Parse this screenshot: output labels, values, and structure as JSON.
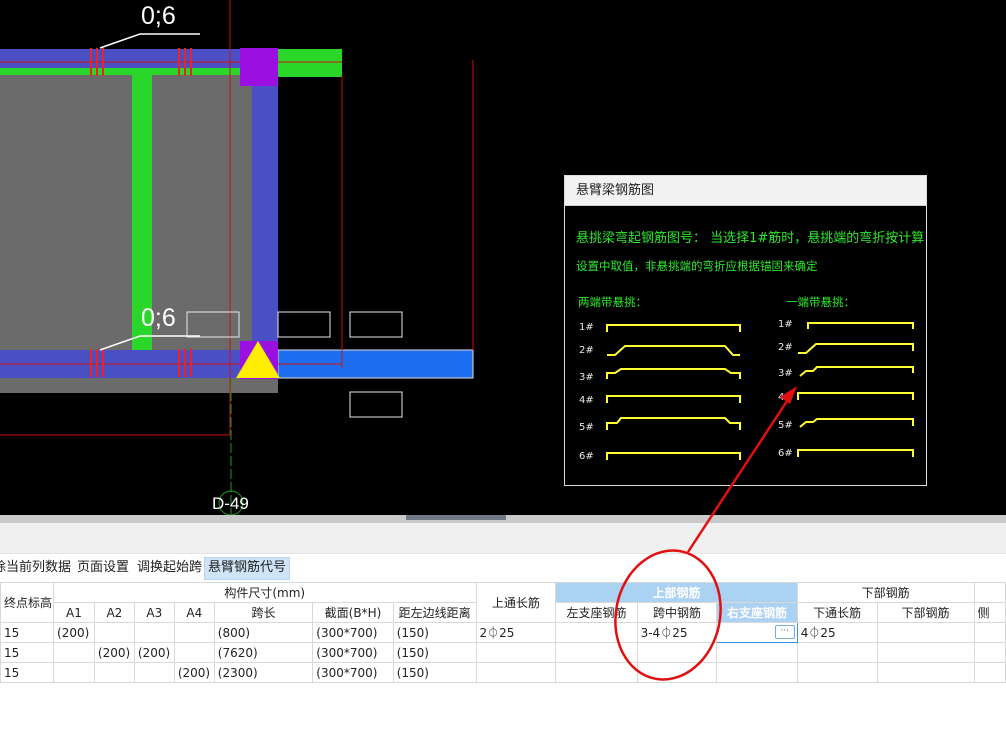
{
  "cad": {
    "span_label_top": "0;6",
    "span_label_bottom": "0;6",
    "axis_label": "D-49"
  },
  "dialog": {
    "title": "悬臂梁钢筋图",
    "heading_line1": "悬挑梁弯起钢筋图号：  当选择1#筋时，悬挑端的弯折按计算",
    "heading_line2": "设置中取值，非悬挑端的弯折应根据锚固来确定",
    "left_group_title": "两端带悬挑：",
    "right_group_title": "一端带悬挑：",
    "left_labels": [
      "1#",
      "2#",
      "3#",
      "4#",
      "5#",
      "6#"
    ],
    "right_labels": [
      "1#",
      "2#",
      "3#",
      "4#",
      "5#",
      "6#"
    ],
    "line_color": "#ffff33",
    "text_color": "#2ee82e"
  },
  "toolbar": {
    "items": [
      "除当前列数据",
      "页面设置",
      "调换起始跨",
      "悬臂钢筋代号"
    ],
    "active_index": 3
  },
  "table": {
    "header_row1": {
      "node_elev": "终点标高",
      "dims": "构件尺寸(mm)",
      "top_through": "上通长筋",
      "top_group": "上部钢筋",
      "bottom_group": "下部钢筋"
    },
    "header_row2": [
      "A1",
      "A2",
      "A3",
      "A4",
      "跨长",
      "截面(B*H)",
      "距左边线距离",
      "左支座钢筋",
      "跨中钢筋",
      "右支座钢筋",
      "下通长筋",
      "下部钢筋",
      "侧"
    ],
    "rows": [
      {
        "elev": "15",
        "a1": "(200)",
        "a2": "",
        "a3": "",
        "a4": "",
        "span": "(800)",
        "section": "(300*700)",
        "offset": "(150)",
        "top_through": "2⏀25",
        "left_sup": "",
        "mid": "3-4⏀25",
        "right_sup": "",
        "bot_through": "4⏀25",
        "bot": ""
      },
      {
        "elev": "15",
        "a1": "",
        "a2": "(200)",
        "a3": "(200)",
        "a4": "",
        "span": "(7620)",
        "section": "(300*700)",
        "offset": "(150)",
        "top_through": "",
        "left_sup": "",
        "mid": "",
        "right_sup": "",
        "bot_through": "",
        "bot": ""
      },
      {
        "elev": "15",
        "a1": "",
        "a2": "",
        "a3": "",
        "a4": "(200)",
        "span": "(2300)",
        "section": "(300*700)",
        "offset": "(150)",
        "top_through": "",
        "left_sup": "",
        "mid": "",
        "right_sup": "",
        "bot_through": "",
        "bot": ""
      }
    ],
    "ellipsis": "···",
    "header_blue": "#abd1f3"
  },
  "annotation": {
    "color": "#e01010"
  }
}
